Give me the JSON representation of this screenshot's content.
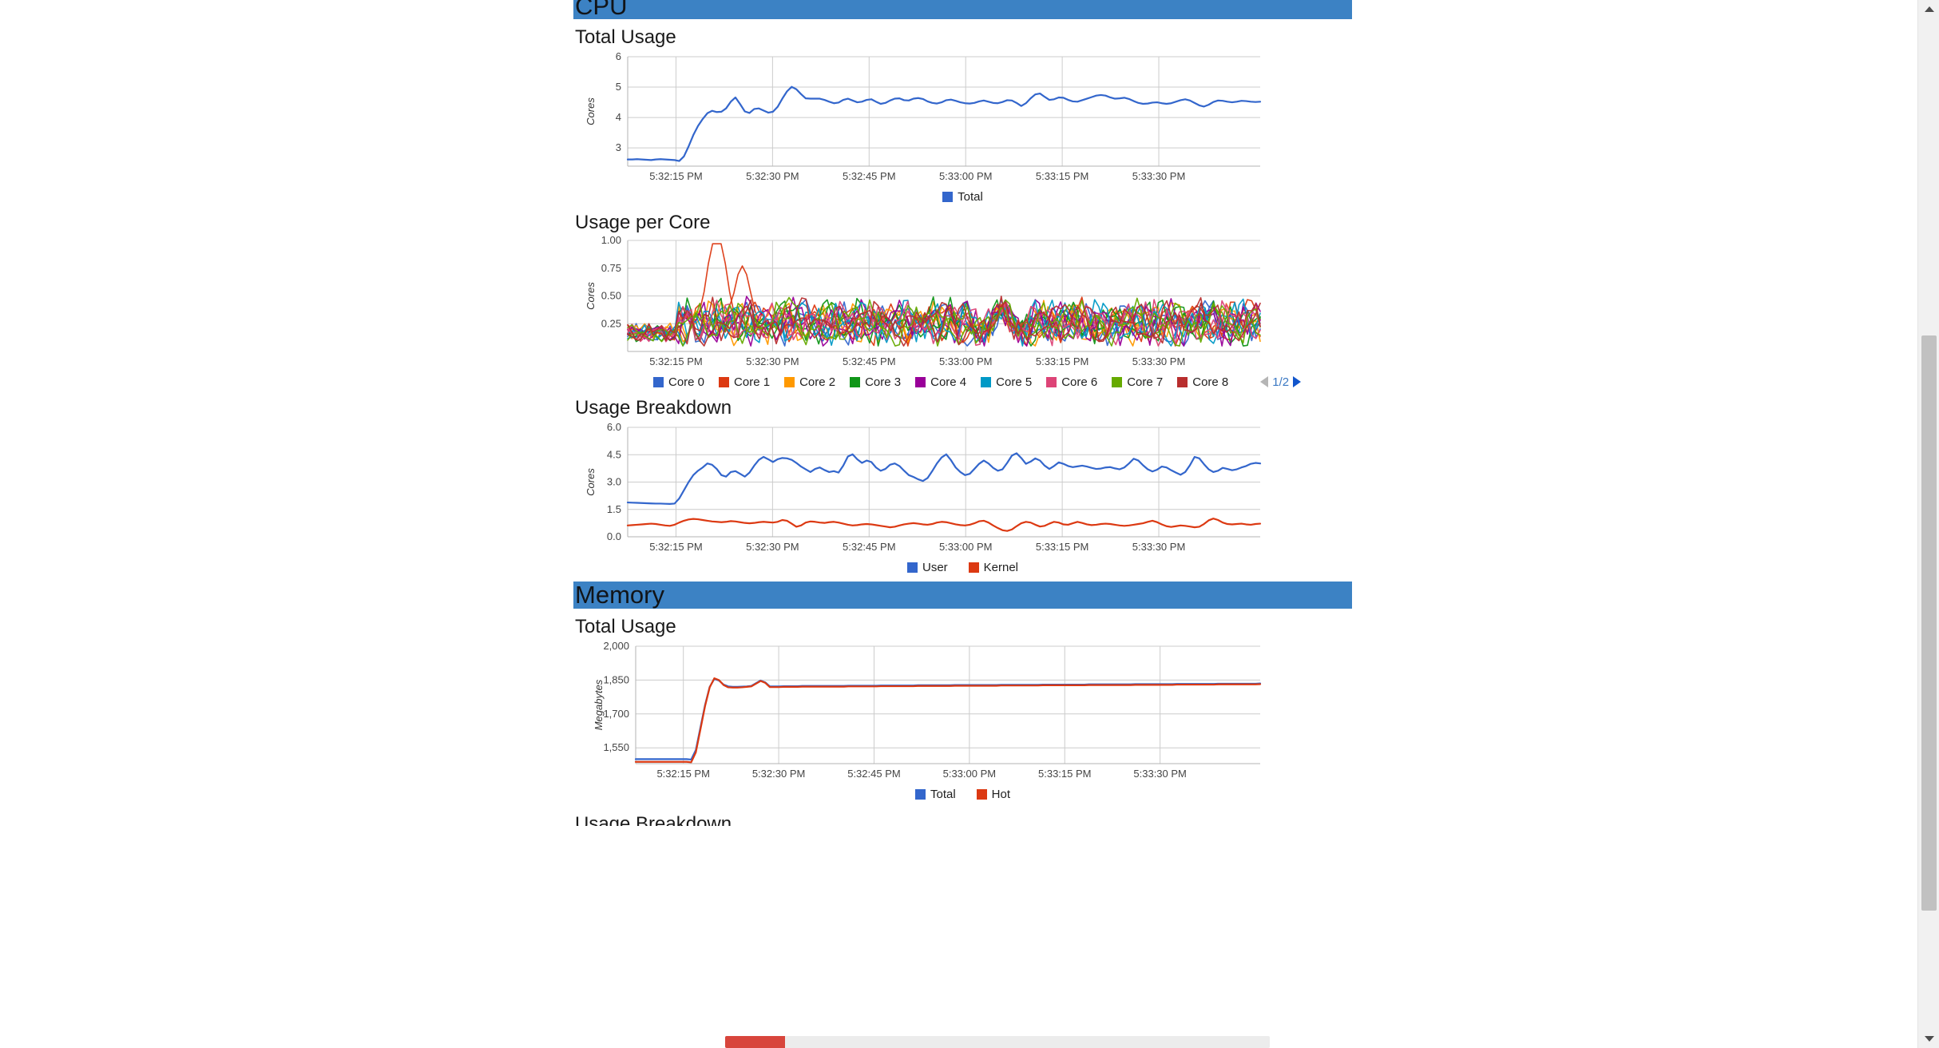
{
  "sections": [
    {
      "id": "cpu",
      "title": "CPU"
    },
    {
      "id": "memory",
      "title": "Memory"
    }
  ],
  "headings": {
    "cpu_total": "Total Usage",
    "cpu_per_core": "Usage per Core",
    "cpu_breakdown": "Usage Breakdown",
    "memory_total": "Total Usage",
    "memory_breakdown": "Usage Breakdown"
  },
  "pager": {
    "label": "1/2",
    "prev": "◀",
    "next": "▶"
  },
  "partial_bar": {
    "fill_percent": 11,
    "fill_color": "#d8453c",
    "track_color": "#ececec"
  },
  "theme": {
    "section_header_bg": "#3c82c4",
    "blue": "#3366cc",
    "red": "#dc3912",
    "orange": "#ff9900",
    "green": "#109618",
    "purple": "#990099",
    "cyan": "#0099c6",
    "pink": "#dd4477",
    "lightgreen": "#66aa00",
    "darkred": "#b82e2e"
  },
  "chart_data": [
    {
      "id": "cpu-total-usage",
      "type": "line",
      "title": "Total Usage",
      "xlabel": "",
      "ylabel": "Cores",
      "ylim": [
        2.4,
        6
      ],
      "yticks": [
        3,
        4,
        5,
        6
      ],
      "ytick_labels": [
        "3",
        "4",
        "5",
        "6"
      ],
      "xticks": [
        "5:32:15 PM",
        "5:32:30 PM",
        "5:32:45 PM",
        "5:33:00 PM",
        "5:33:15 PM",
        "5:33:30 PM"
      ],
      "grid": true,
      "legend_position": "bottom",
      "series": [
        {
          "name": "Total",
          "color": "#3366cc",
          "values": [
            2.62,
            2.62,
            2.63,
            2.62,
            2.61,
            2.6,
            2.62,
            2.63,
            2.62,
            2.61,
            2.6,
            2.57,
            2.72,
            3.05,
            3.42,
            3.72,
            3.95,
            4.14,
            4.22,
            4.18,
            4.19,
            4.3,
            4.52,
            4.66,
            4.44,
            4.2,
            4.15,
            4.28,
            4.3,
            4.23,
            4.16,
            4.19,
            4.35,
            4.62,
            4.86,
            5.01,
            4.93,
            4.77,
            4.63,
            4.62,
            4.62,
            4.62,
            4.58,
            4.52,
            4.47,
            4.49,
            4.58,
            4.62,
            4.56,
            4.5,
            4.52,
            4.58,
            4.6,
            4.52,
            4.45,
            4.48,
            4.56,
            4.62,
            4.63,
            4.57,
            4.56,
            4.62,
            4.64,
            4.61,
            4.53,
            4.48,
            4.46,
            4.5,
            4.57,
            4.59,
            4.55,
            4.5,
            4.47,
            4.46,
            4.48,
            4.53,
            4.56,
            4.52,
            4.48,
            4.47,
            4.51,
            4.57,
            4.56,
            4.48,
            4.38,
            4.47,
            4.63,
            4.76,
            4.79,
            4.68,
            4.58,
            4.6,
            4.66,
            4.65,
            4.58,
            4.53,
            4.52,
            4.57,
            4.62,
            4.67,
            4.72,
            4.74,
            4.72,
            4.66,
            4.62,
            4.63,
            4.65,
            4.61,
            4.54,
            4.48,
            4.45,
            4.46,
            4.49,
            4.5,
            4.47,
            4.45,
            4.47,
            4.52,
            4.57,
            4.6,
            4.56,
            4.48,
            4.4,
            4.36,
            4.42,
            4.51,
            4.56,
            4.55,
            4.52,
            4.5,
            4.52,
            4.55,
            4.54,
            4.52,
            4.51,
            4.52
          ]
        }
      ]
    },
    {
      "id": "cpu-usage-per-core",
      "type": "line",
      "title": "Usage per Core",
      "xlabel": "",
      "ylabel": "Cores",
      "ylim": [
        0,
        1.0
      ],
      "yticks": [
        0.25,
        0.5,
        0.75,
        1.0
      ],
      "ytick_labels": [
        "0.25",
        "0.50",
        "0.75",
        "1.00"
      ],
      "xticks": [
        "5:32:15 PM",
        "5:32:30 PM",
        "5:32:45 PM",
        "5:33:00 PM",
        "5:33:15 PM",
        "5:33:30 PM"
      ],
      "grid": true,
      "legend_position": "bottom",
      "legend_page": "1/2",
      "series": [
        {
          "name": "Core 0",
          "color": "#3366cc"
        },
        {
          "name": "Core 1",
          "color": "#dc3912"
        },
        {
          "name": "Core 2",
          "color": "#ff9900"
        },
        {
          "name": "Core 3",
          "color": "#109618"
        },
        {
          "name": "Core 4",
          "color": "#990099"
        },
        {
          "name": "Core 5",
          "color": "#0099c6"
        },
        {
          "name": "Core 6",
          "color": "#dd4477"
        },
        {
          "name": "Core 7",
          "color": "#66aa00"
        },
        {
          "name": "Core 8",
          "color": "#b82e2e"
        }
      ],
      "notes": "Dense overlapping traces oscillating between 0.10 and 0.55, with one red spike to 0.92 just after 5:32:20 PM."
    },
    {
      "id": "cpu-usage-breakdown",
      "type": "line",
      "title": "Usage Breakdown",
      "xlabel": "",
      "ylabel": "Cores",
      "ylim": [
        0,
        6.0
      ],
      "yticks": [
        0.0,
        1.5,
        3.0,
        4.5,
        6.0
      ],
      "ytick_labels": [
        "0.0",
        "1.5",
        "3.0",
        "4.5",
        "6.0"
      ],
      "xticks": [
        "5:32:15 PM",
        "5:32:30 PM",
        "5:32:45 PM",
        "5:33:00 PM",
        "5:33:15 PM",
        "5:33:30 PM"
      ],
      "grid": true,
      "legend_position": "bottom",
      "series": [
        {
          "name": "User",
          "color": "#3366cc",
          "values": [
            1.88,
            1.87,
            1.86,
            1.85,
            1.84,
            1.83,
            1.82,
            1.82,
            1.81,
            1.8,
            1.82,
            2.1,
            2.55,
            3.0,
            3.38,
            3.62,
            3.8,
            4.02,
            3.95,
            3.72,
            3.38,
            3.3,
            3.55,
            3.6,
            3.45,
            3.3,
            3.52,
            3.9,
            4.22,
            4.38,
            4.25,
            4.1,
            4.25,
            4.32,
            4.3,
            4.22,
            4.05,
            3.85,
            3.7,
            3.55,
            3.72,
            3.8,
            3.66,
            3.55,
            3.6,
            3.52,
            3.9,
            4.4,
            4.52,
            4.25,
            4.05,
            4.18,
            4.1,
            3.8,
            3.62,
            3.72,
            3.95,
            4.02,
            3.88,
            3.62,
            3.38,
            3.28,
            3.15,
            3.06,
            3.22,
            3.6,
            4.02,
            4.35,
            4.52,
            4.2,
            3.8,
            3.55,
            3.38,
            3.45,
            3.72,
            4.0,
            4.18,
            4.02,
            3.78,
            3.62,
            3.7,
            4.05,
            4.45,
            4.58,
            4.32,
            4.0,
            4.12,
            4.3,
            4.18,
            3.9,
            3.72,
            3.88,
            4.08,
            4.0,
            3.88,
            3.82,
            3.86,
            3.9,
            3.85,
            3.78,
            3.72,
            3.74,
            3.8,
            3.82,
            3.75,
            3.7,
            3.8,
            4.02,
            4.28,
            4.18,
            3.92,
            3.7,
            3.58,
            3.68,
            3.85,
            3.8,
            3.65,
            3.52,
            3.4,
            3.55,
            3.92,
            4.38,
            4.3,
            3.98,
            3.7,
            3.55,
            3.62,
            3.78,
            3.72,
            3.65,
            3.7,
            3.8,
            3.88,
            4.0,
            4.05,
            4.02
          ]
        },
        {
          "name": "Kernel",
          "color": "#dc3912",
          "values": [
            0.62,
            0.64,
            0.66,
            0.68,
            0.7,
            0.72,
            0.7,
            0.66,
            0.62,
            0.6,
            0.66,
            0.78,
            0.88,
            0.95,
            0.98,
            0.96,
            0.92,
            0.88,
            0.84,
            0.82,
            0.8,
            0.82,
            0.86,
            0.84,
            0.8,
            0.76,
            0.74,
            0.76,
            0.8,
            0.82,
            0.8,
            0.78,
            0.82,
            0.92,
            0.88,
            0.72,
            0.55,
            0.62,
            0.78,
            0.84,
            0.82,
            0.78,
            0.76,
            0.8,
            0.82,
            0.78,
            0.72,
            0.66,
            0.62,
            0.64,
            0.68,
            0.7,
            0.68,
            0.64,
            0.6,
            0.56,
            0.52,
            0.55,
            0.62,
            0.68,
            0.72,
            0.75,
            0.72,
            0.68,
            0.66,
            0.7,
            0.78,
            0.82,
            0.8,
            0.74,
            0.68,
            0.64,
            0.62,
            0.66,
            0.74,
            0.85,
            0.88,
            0.78,
            0.62,
            0.48,
            0.36,
            0.32,
            0.4,
            0.58,
            0.74,
            0.82,
            0.78,
            0.66,
            0.56,
            0.6,
            0.72,
            0.82,
            0.78,
            0.68,
            0.66,
            0.74,
            0.82,
            0.76,
            0.68,
            0.64,
            0.66,
            0.7,
            0.72,
            0.7,
            0.66,
            0.62,
            0.6,
            0.62,
            0.66,
            0.7,
            0.74,
            0.82,
            0.88,
            0.8,
            0.68,
            0.58,
            0.54,
            0.58,
            0.62,
            0.6,
            0.56,
            0.52,
            0.55,
            0.7,
            0.9,
            1.0,
            0.92,
            0.78,
            0.7,
            0.68,
            0.7,
            0.72,
            0.68,
            0.66,
            0.7,
            0.72
          ]
        }
      ]
    },
    {
      "id": "memory-total-usage",
      "type": "line",
      "title": "Total Usage",
      "xlabel": "",
      "ylabel": "Megabytes",
      "ylim": [
        1480,
        2000
      ],
      "yticks": [
        1550,
        1700,
        1850,
        2000
      ],
      "ytick_labels": [
        "1,550",
        "1,700",
        "1,850",
        "2,000"
      ],
      "xticks": [
        "5:32:15 PM",
        "5:32:30 PM",
        "5:32:45 PM",
        "5:33:00 PM",
        "5:33:15 PM",
        "5:33:30 PM"
      ],
      "grid": true,
      "legend_position": "bottom",
      "series": [
        {
          "name": "Total",
          "color": "#3366cc",
          "values": [
            1500,
            1500,
            1500,
            1500,
            1500,
            1500,
            1500,
            1500,
            1500,
            1500,
            1500,
            1500,
            1498,
            1540,
            1640,
            1740,
            1820,
            1855,
            1848,
            1830,
            1822,
            1820,
            1820,
            1821,
            1822,
            1824,
            1836,
            1848,
            1840,
            1822,
            1822,
            1822,
            1823,
            1823,
            1823,
            1823,
            1824,
            1824,
            1824,
            1824,
            1824,
            1824,
            1824,
            1824,
            1824,
            1824,
            1825,
            1825,
            1825,
            1825,
            1825,
            1825,
            1825,
            1826,
            1826,
            1826,
            1826,
            1826,
            1826,
            1826,
            1826,
            1827,
            1827,
            1827,
            1827,
            1827,
            1827,
            1827,
            1827,
            1828,
            1828,
            1828,
            1828,
            1828,
            1828,
            1828,
            1828,
            1828,
            1828,
            1829,
            1829,
            1829,
            1829,
            1829,
            1829,
            1829,
            1829,
            1829,
            1830,
            1830,
            1830,
            1830,
            1830,
            1830,
            1830,
            1830,
            1830,
            1830,
            1831,
            1831,
            1831,
            1831,
            1831,
            1831,
            1831,
            1831,
            1831,
            1831,
            1832,
            1832,
            1832,
            1832,
            1832,
            1832,
            1832,
            1832,
            1832,
            1833,
            1833,
            1833,
            1833,
            1833,
            1833,
            1833,
            1833,
            1833,
            1834,
            1834,
            1834,
            1834,
            1834,
            1834,
            1834,
            1834,
            1834,
            1835
          ]
        },
        {
          "name": "Hot",
          "color": "#dc3912",
          "values": [
            1488,
            1488,
            1488,
            1488,
            1488,
            1488,
            1488,
            1488,
            1488,
            1488,
            1488,
            1488,
            1486,
            1530,
            1632,
            1735,
            1818,
            1858,
            1850,
            1828,
            1818,
            1817,
            1817,
            1818,
            1820,
            1822,
            1834,
            1846,
            1838,
            1819,
            1819,
            1819,
            1820,
            1820,
            1820,
            1820,
            1821,
            1821,
            1821,
            1821,
            1821,
            1821,
            1821,
            1821,
            1821,
            1821,
            1822,
            1822,
            1822,
            1822,
            1822,
            1822,
            1822,
            1823,
            1823,
            1823,
            1823,
            1823,
            1823,
            1823,
            1823,
            1824,
            1824,
            1824,
            1824,
            1824,
            1824,
            1824,
            1824,
            1825,
            1825,
            1825,
            1825,
            1825,
            1825,
            1825,
            1825,
            1825,
            1825,
            1826,
            1826,
            1826,
            1826,
            1826,
            1826,
            1826,
            1826,
            1826,
            1827,
            1827,
            1827,
            1827,
            1827,
            1827,
            1827,
            1827,
            1827,
            1827,
            1828,
            1828,
            1828,
            1828,
            1828,
            1828,
            1828,
            1828,
            1828,
            1828,
            1829,
            1829,
            1829,
            1829,
            1829,
            1829,
            1829,
            1829,
            1829,
            1830,
            1830,
            1830,
            1830,
            1830,
            1830,
            1830,
            1830,
            1830,
            1831,
            1831,
            1831,
            1831,
            1831,
            1831,
            1831,
            1831,
            1831,
            1832
          ]
        }
      ]
    }
  ],
  "scrollbar": {
    "thumb_top": 420,
    "thumb_height": 720
  }
}
